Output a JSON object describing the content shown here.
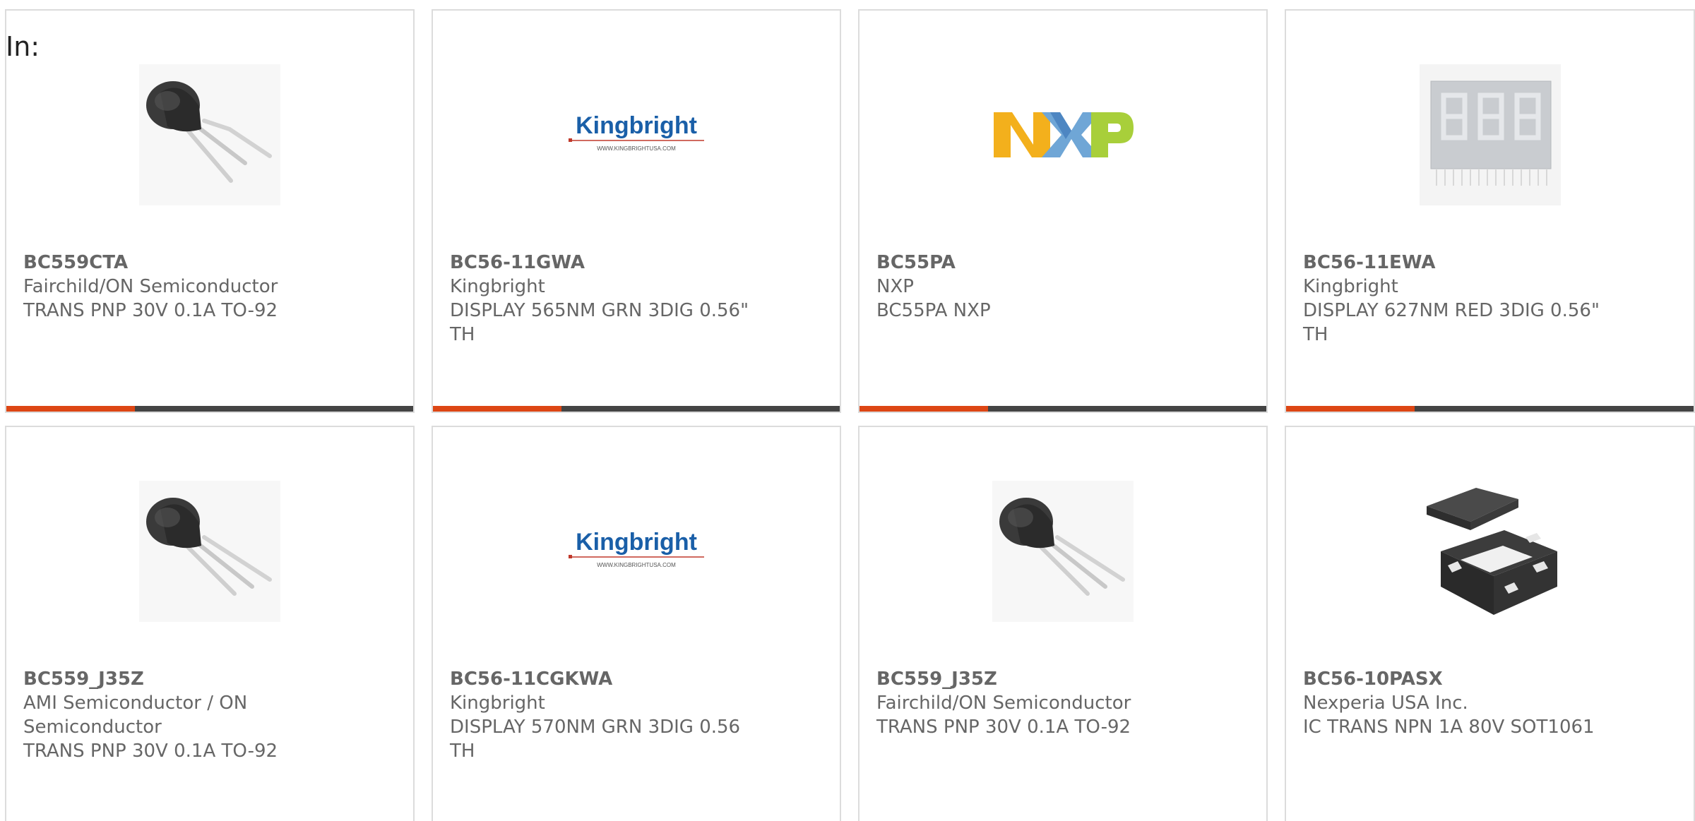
{
  "page": {
    "in_label": "In:"
  },
  "colors": {
    "accent": "#dd4614",
    "bar": "#444444",
    "border": "#dcdcdc",
    "text": "#666666"
  },
  "cards": [
    {
      "part_number": "BC559CTA",
      "manufacturer": "Fairchild/ON Semiconductor",
      "description": "TRANS PNP 30V 0.1A TO-92",
      "image": "to92-transistor-image"
    },
    {
      "part_number": "BC56-11GWA",
      "manufacturer": "Kingbright",
      "description": "DISPLAY 565NM GRN 3DIG 0.56\" TH",
      "image": "kingbright-logo",
      "logo_text": "Kingbright",
      "logo_sub": "WWW.KINGBRIGHTUSA.COM"
    },
    {
      "part_number": "BC55PA",
      "manufacturer": "NXP",
      "description": "BC55PA NXP",
      "image": "nxp-logo"
    },
    {
      "part_number": "BC56-11EWA",
      "manufacturer": "Kingbright",
      "description": "DISPLAY 627NM RED 3DIG 0.56\" TH",
      "image": "seven-segment-display-image"
    },
    {
      "part_number": "BC559_J35Z",
      "manufacturer": "AMI Semiconductor / ON Semiconductor",
      "description": "TRANS PNP 30V 0.1A TO-92",
      "image": "to92-transistor-image"
    },
    {
      "part_number": "BC56-11CGKWA",
      "manufacturer": "Kingbright",
      "description": "DISPLAY 570NM GRN 3DIG 0.56 TH",
      "image": "kingbright-logo",
      "logo_text": "Kingbright",
      "logo_sub": "WWW.KINGBRIGHTUSA.COM"
    },
    {
      "part_number": "BC559_J35Z",
      "manufacturer": "Fairchild/ON Semiconductor",
      "description": "TRANS PNP 30V 0.1A TO-92",
      "image": "to92-transistor-image"
    },
    {
      "part_number": "BC56-10PASX",
      "manufacturer": "Nexperia USA Inc.",
      "description": "IC TRANS NPN 1A 80V SOT1061",
      "image": "sot1061-package-image"
    }
  ]
}
